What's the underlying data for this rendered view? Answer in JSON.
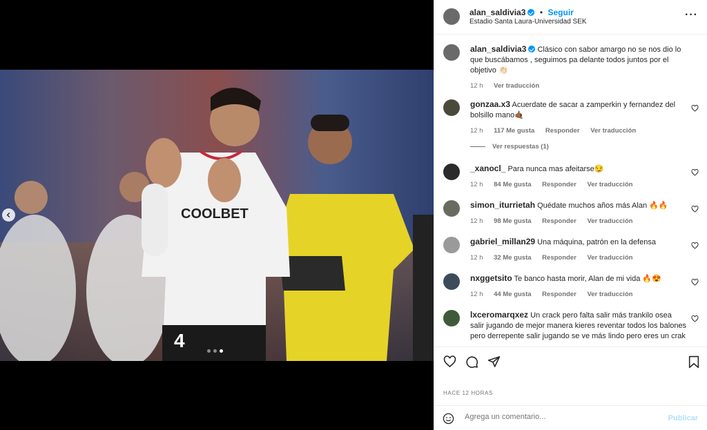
{
  "post": {
    "username": "alan_saldivia3",
    "follow_label": "Seguir",
    "location": "Estadio Santa Laura-Universidad SEK",
    "more_label": "···",
    "carousel_total": 3,
    "carousel_active": 3
  },
  "caption": {
    "username": "alan_saldivia3",
    "text": "Clásico con sabor amargo no se nos dio lo que buscábamos , seguimos pa delante todos juntos por el objetivo 👏🏻",
    "time": "12 h",
    "translate": "Ver traducción"
  },
  "comments": [
    {
      "username": "gonzaa.x3",
      "text": "Acuerdate de sacar a zamperkin y fernandez del bolsillo mano🤙🏾",
      "time": "12 h",
      "likes": "117 Me gusta",
      "reply": "Responder",
      "translate": "Ver traducción",
      "avatar_color": "#4a4a3c"
    },
    {
      "username": "_xanocl_",
      "text": "Para nunca mas afeitarse😏",
      "time": "12 h",
      "likes": "84 Me gusta",
      "reply": "Responder",
      "translate": "Ver traducción",
      "avatar_color": "#2b2b2b"
    },
    {
      "username": "simon_iturrietah",
      "text": "Quédate muchos años más Alan 🔥🔥",
      "time": "12 h",
      "likes": "98 Me gusta",
      "reply": "Responder",
      "translate": "Ver traducción",
      "avatar_color": "#6b6a62"
    },
    {
      "username": "gabriel_millan29",
      "text": "Una máquina, patrón en la defensa",
      "time": "12 h",
      "likes": "32 Me gusta",
      "reply": "Responder",
      "translate": "Ver traducción",
      "avatar_color": "#9a9a9a"
    },
    {
      "username": "nxggetsito",
      "text": "Te banco hasta morir, Alan de mi vida 🔥😍",
      "time": "12 h",
      "likes": "44 Me gusta",
      "reply": "Responder",
      "translate": "Ver traducción",
      "avatar_color": "#3d4a5a"
    },
    {
      "username": "lxceromarqxez",
      "text": "Un crack pero falta salir más trankilo osea salir jugando de mejor manera kieres reventar todos los balones pero derrepente salir jugando se ve más lindo pero eres un crak",
      "time": "",
      "likes": "",
      "reply": "",
      "translate": "",
      "avatar_color": "#3f5a3a"
    }
  ],
  "replies_label": "Ver respuestas (1)",
  "timestamp": "HACE 12 HORAS",
  "composer": {
    "placeholder": "Agrega un comentario...",
    "post_label": "Publicar"
  },
  "icons": [
    "heart-icon",
    "comment-icon",
    "share-icon",
    "bookmark-icon",
    "emoji-icon",
    "chevron-left-icon",
    "more-icon",
    "verified-icon"
  ],
  "colors": {
    "accent": "#0095f6",
    "muted": "#737373",
    "post_disabled": "#b2dffc"
  }
}
